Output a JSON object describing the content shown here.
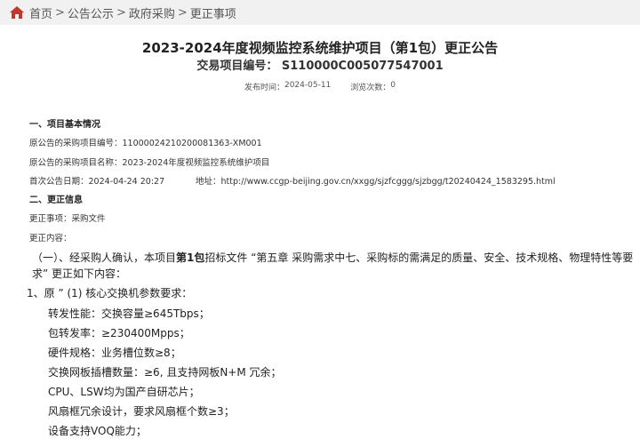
{
  "breadcrumb": {
    "home": "首页",
    "separator": ">",
    "items": [
      "公告公示",
      "政府采购",
      "更正事项"
    ]
  },
  "notice": {
    "title": "2023-2024年度视频监控系统维护项目（第1包）更正公告",
    "trade_no": "交易项目编号： S110000C005077547001",
    "publish_label": "发布时间：",
    "publish_date": "2024-05-11",
    "views_label": "浏览次数：",
    "views_count": "0"
  },
  "section1": {
    "heading": "一、项目基本情况",
    "orig_no": "原公告的采购项目编号：11000024210200081363-XM001",
    "orig_name": "原公告的采购项目名称：2023-2024年度视频监控系统维护项目",
    "first_date": "首次公告日期：2024-04-24 20:27",
    "address": "地址：http://www.ccgp-beijing.gov.cn/xxgg/sjzfcggg/sjzbgg/t20240424_1583295.html"
  },
  "section2": {
    "heading": "二、更正信息",
    "item": "更正事项：采购文件",
    "content_label": "更正内容："
  },
  "body": {
    "para1_a": "（一）、经采购人确认，本项目",
    "para1_b": "第1包",
    "para1_c": "招标文件 “第五章 采购需求中七、采购标的需满足的质量、安全、技术规格、物理特性等要",
    "para1_d": "求” 更正如下内容：",
    "para2": "1、原 ” (1) 核心交换机参数要求：",
    "lines": [
      "转发性能：交换容量≥645Tbps；",
      "包转发率：≥230400Mpps；",
      "硬件规格：业务槽位数≥8；",
      "交换网板插槽数量：≥6, 且支持网板N+M 冗余；",
      "CPU、LSW均为国产自研芯片；",
      "风扇框冗余设计，要求风扇框个数≥3；",
      "设备支持VOQ能力；"
    ]
  },
  "colors": {
    "home_icon": "#c0392b",
    "breadcrumb_bg": "#f1f1f1"
  }
}
